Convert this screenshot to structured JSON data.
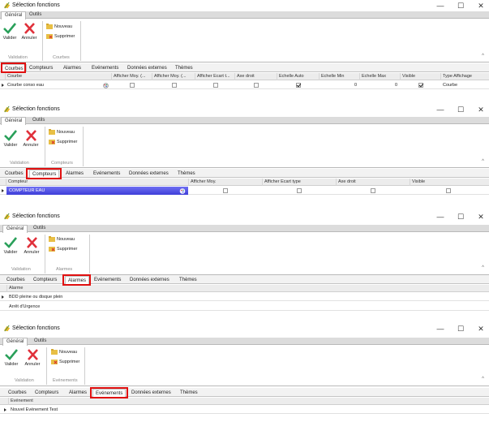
{
  "window": {
    "title": "Sélection fonctions"
  },
  "window_controls": {
    "minimize": "—",
    "maximize": "☐",
    "close": "✕"
  },
  "ribbon": {
    "tabs": [
      "Général",
      "Outils"
    ],
    "validation": {
      "valider": "Valider",
      "annuler": "Annuler",
      "group_label": "Validation"
    },
    "actions": {
      "nouveau": "Nouveau",
      "supprimer": "Supprimer"
    },
    "group_labels": [
      "Courbes",
      "Compteurs",
      "Alarmes",
      "Evénements"
    ],
    "collapse": "^"
  },
  "data_tabs": [
    "Courbes",
    "Compteurs",
    "Alarmes",
    "Evénements",
    "Données externes",
    "Thèmes"
  ],
  "courbes": {
    "columns": [
      "Courbe",
      "Afficher Moy. (...",
      "Afficher Moy. (...",
      "Afficher Ecart t...",
      "Axe droit",
      "Echelle Auto",
      "Echelle Min",
      "Echelle Max",
      "Visible",
      "Type Affichage"
    ],
    "row": {
      "name": "Courbe conso eau",
      "afficher_moy_1": false,
      "afficher_moy_2": false,
      "afficher_ecart": false,
      "axe_droit": false,
      "echelle_auto": true,
      "echelle_min": "0",
      "echelle_max": "0",
      "visible": true,
      "type_affichage": "Courbe"
    }
  },
  "compteurs": {
    "columns": [
      "Compteur",
      "Afficher Moy.",
      "Afficher Ecart type",
      "Axe droit",
      "Visible"
    ],
    "row": {
      "name": "COMPTEUR EAU",
      "afficher_moy": false,
      "afficher_ecart": false,
      "axe_droit": false,
      "visible": false
    }
  },
  "alarmes": {
    "columns": [
      "Alarme"
    ],
    "rows": [
      "BDD pleine ou disque plein",
      "Arrêt d'Urgence"
    ]
  },
  "evenements": {
    "columns": [
      "Evénement"
    ],
    "rows": [
      "Nouvel Evénement Test"
    ]
  },
  "colors": {
    "highlight": "#e01010",
    "selection": "#4b4be0",
    "check_green": "#2aa05a",
    "cross_red": "#e0303a"
  }
}
